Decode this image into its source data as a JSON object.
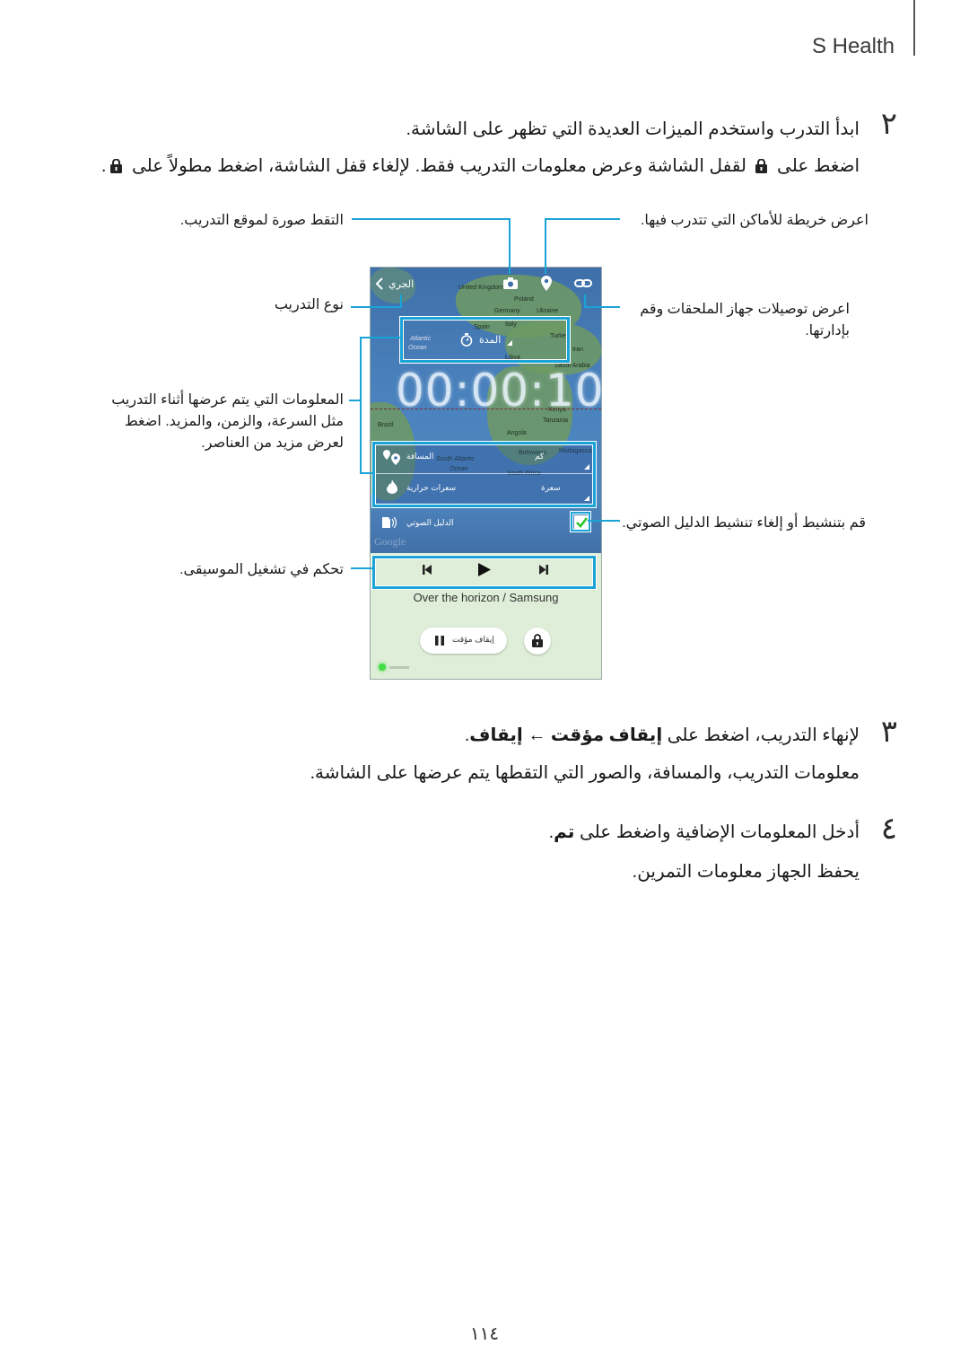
{
  "header": {
    "title": "S Health"
  },
  "step2": {
    "number": "٢",
    "line1": "ابدأ التدرب واستخدم الميزات العديدة التي تظهر على الشاشة.",
    "line2_a": "اضغط على",
    "line2_b": "لقفل الشاشة وعرض معلومات التدريب فقط. لإلغاء قفل الشاشة، اضغط مطولاً على",
    "line2_c": "."
  },
  "callouts": {
    "photo": "التقط صورة لموقع التدريب.",
    "map": "اعرض خريطة للأماكن التي تتدرب فيها.",
    "workout_type": "نوع التدريب",
    "accessories_1": "اعرض توصيلات جهاز الملحقات وقم",
    "accessories_2": "بإدارتها.",
    "info_1": "المعلومات التي يتم عرضها أثناء التدريب",
    "info_2": "مثل السرعة، والزمن، والمزيد. اضغط",
    "info_3": "لعرض مزيد من العناصر.",
    "voice": "قم بتنشيط أو إلغاء تنشيط الدليل الصوتي.",
    "music": "تحكم في تشغيل الموسيقى."
  },
  "phone": {
    "back_label": "الجري",
    "duration_label": "المدة",
    "timer": "00:00:10",
    "distance_label": "المسافة",
    "distance_unit": "كم",
    "calories_label": "سعرات حرارية",
    "calories_unit": "سعرة",
    "voice_guide_label": "الدليل الصوتي",
    "voice_guide_checked": true,
    "map_brand": "Google",
    "map_labels": [
      "United Kingdom",
      "Poland",
      "Germany",
      "Ukraine",
      "Spain",
      "Italy",
      "Turkey",
      "Atlantic",
      "Ocean",
      "Libya",
      "Saudi Arabia",
      "Iran",
      "Kenya",
      "Tanzania",
      "Brazil",
      "Angola",
      "Botswana",
      "Madagascar",
      "South Atlantic",
      "Ocean",
      "South Africa"
    ],
    "song": "Over the horizon / Samsung",
    "pause_label": "إيقاف مؤقت",
    "colors": {
      "accent": "#1aa3d6",
      "check": "#2ec42e",
      "music_bg": "#dfeed8"
    }
  },
  "step3": {
    "number": "٣",
    "line1_a": "لإنهاء التدريب، اضغط على",
    "line1_b": "إيقاف مؤقت",
    "line1_arrow": "←",
    "line1_c": "إيقاف",
    "line1_d": ".",
    "line2": "معلومات التدريب، والمسافة، والصور التي التقطها يتم عرضها على الشاشة."
  },
  "step4": {
    "number": "٤",
    "line1_a": "أدخل المعلومات الإضافية واضغط على",
    "line1_b": "تم",
    "line1_c": ".",
    "line2": "يحفظ الجهاز معلومات التمرين."
  },
  "page_number": "١١٤"
}
